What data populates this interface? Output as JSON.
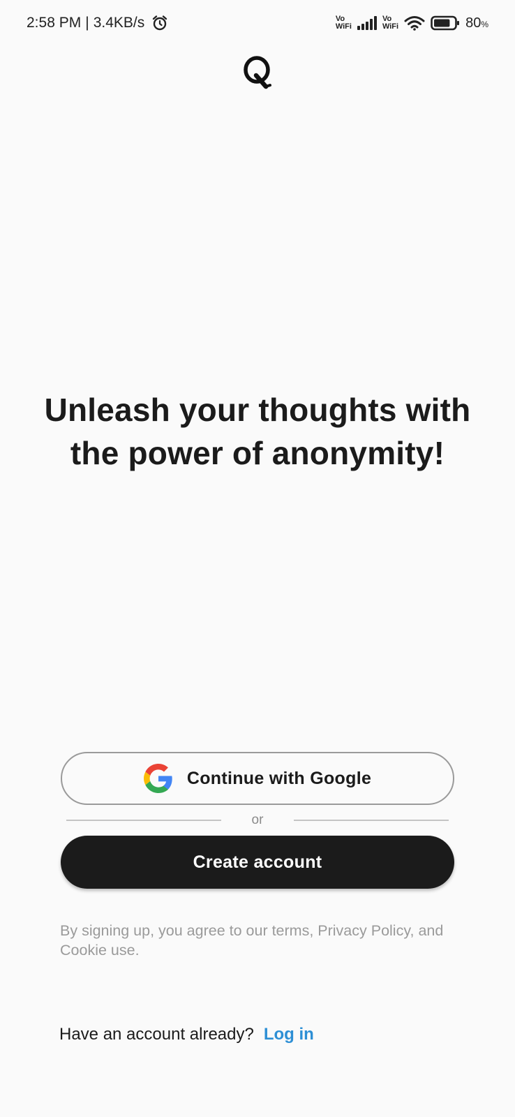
{
  "status_bar": {
    "time": "2:58 PM",
    "separator": "|",
    "speed": "3.4KB/s",
    "alarm_icon": "alarm-clock-icon",
    "vowifi_top": "Vo",
    "vowifi_bottom": "WiFi",
    "battery_percent": "80",
    "battery_unit": "%",
    "battery_level": 0.8
  },
  "app": {
    "logo_letter": "Q"
  },
  "headline": {
    "line1": "Unleash your thoughts with",
    "line2": "the power of anonymity!"
  },
  "auth": {
    "google_label": "Continue with Google",
    "divider_label": "or",
    "create_label": "Create account",
    "terms": "By signing up, you agree to our terms, Privacy Policy, and Cookie use.",
    "login_prompt": "Have an account already?",
    "login_link": "Log in"
  },
  "colors": {
    "background": "#fafafa",
    "primary_button": "#1b1b1b",
    "link": "#2d8fd5",
    "muted_text": "#9a9a9a"
  }
}
